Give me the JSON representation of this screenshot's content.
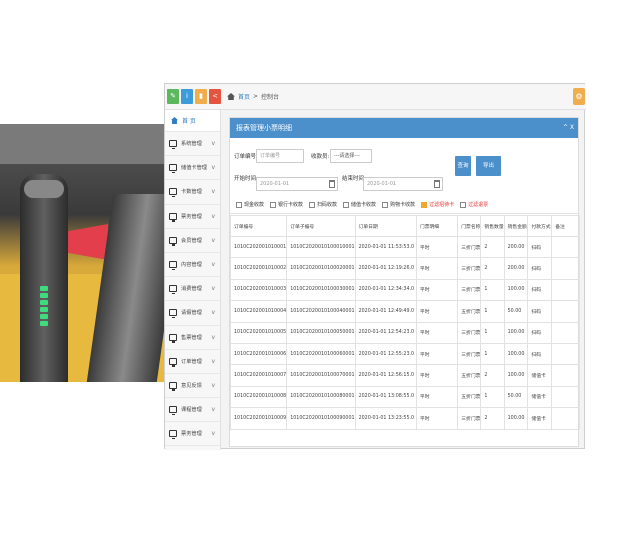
{
  "topbar": {
    "square_icons": [
      {
        "icon": "edit-icon",
        "color": "#5cb85c"
      },
      {
        "icon": "info-icon",
        "color": "#3b9cd9"
      },
      {
        "icon": "trash-icon",
        "color": "#f0ad4e"
      },
      {
        "icon": "share-icon",
        "color": "#e4543f"
      }
    ],
    "breadcrumb_home": "首页",
    "breadcrumb_sep": ">",
    "breadcrumb_current": "控制台",
    "gear_icon": "gear-icon"
  },
  "sidebar": {
    "first": "首 页",
    "items": [
      "系统管理",
      "储值卡管理",
      "卡数管理",
      "票务管理",
      "会员管理",
      "内容管理",
      "消费管理",
      "请假管理",
      "售票管理",
      "订单管理",
      "意见反馈",
      "课程管理",
      "票务管理"
    ]
  },
  "panel": {
    "title": "报表管理小票明细",
    "controls": "^ X"
  },
  "filters": {
    "order_no_label": "订单编号:",
    "order_no_placeholder": "订单编号",
    "cashier_label": "收款员:",
    "cashier_value": "---请选择---",
    "start_label": "开始时间:",
    "start_value": "2020-01-01",
    "end_label": "结束时间:",
    "end_value": "2020-01-01",
    "query_btn": "查询",
    "export_btn": "导出Excel",
    "checkboxes": [
      {
        "label": "现金收款",
        "checked": false,
        "red": false
      },
      {
        "label": "银行卡收款",
        "checked": false,
        "red": false
      },
      {
        "label": "扫码收款",
        "checked": false,
        "red": false
      },
      {
        "label": "储值卡收款",
        "checked": false,
        "red": false
      },
      {
        "label": "购物卡收款",
        "checked": false,
        "red": false
      },
      {
        "label": "过滤招待卡",
        "checked": true,
        "red": true
      },
      {
        "label": "过滤退票",
        "checked": false,
        "red": true
      }
    ]
  },
  "table": {
    "headers": [
      "订单编号",
      "订单子编号",
      "订单日期",
      "门票明细",
      "门票名称",
      "销售数量",
      "销售金额",
      "付款方式",
      "备注"
    ],
    "rows": [
      [
        "1010C202001010001",
        "1010C2020010100010001",
        "2020-01-01 11:53:53.0",
        "平时",
        "三折门票",
        "2",
        "200.00",
        "扫码",
        ""
      ],
      [
        "1010C202001010002",
        "1010C2020010100020001",
        "2020-01-01 12:19:26.0",
        "平时",
        "三折门票",
        "2",
        "200.00",
        "扫码",
        ""
      ],
      [
        "1010C202001010003",
        "1010C2020010100030001",
        "2020-01-01 12:34:34.0",
        "平时",
        "三折门票",
        "1",
        "100.00",
        "扫码",
        ""
      ],
      [
        "1010C202001010004",
        "1010C2020010100040001",
        "2020-01-01 12:49:49.0",
        "平时",
        "五折门票",
        "1",
        "50.00",
        "扫码",
        ""
      ],
      [
        "1010C202001010005",
        "1010C2020010100050001",
        "2020-01-01 12:54:23.0",
        "平时",
        "三折门票",
        "1",
        "100.00",
        "扫码",
        ""
      ],
      [
        "1010C202001010006",
        "1010C2020010100060001",
        "2020-01-01 12:55:23.0",
        "平时",
        "三折门票",
        "1",
        "100.00",
        "扫码",
        ""
      ],
      [
        "1010C202001010007",
        "1010C2020010100070001",
        "2020-01-01 12:56:15.0",
        "平时",
        "五折门票",
        "2",
        "100.00",
        "储值卡",
        ""
      ],
      [
        "1010C202001010008",
        "1010C2020010100080001",
        "2020-01-01 13:08:55.0",
        "平时",
        "五折门票",
        "1",
        "50.00",
        "储值卡",
        ""
      ],
      [
        "1010C202001010009",
        "1010C2020010100090001",
        "2020-01-01 13:23:55.0",
        "平时",
        "三折门票",
        "2",
        "100.00",
        "储值卡",
        ""
      ]
    ]
  }
}
